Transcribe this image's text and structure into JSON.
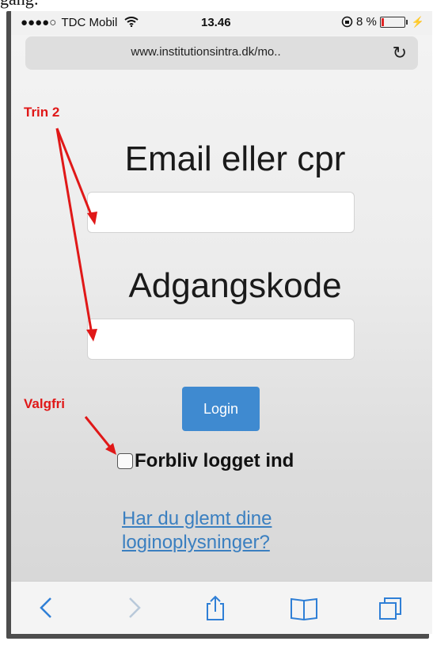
{
  "top_fragment": "gang:",
  "status": {
    "signal": "●●●●○",
    "carrier": "TDC Mobil",
    "time": "13.46",
    "battery": "8 %"
  },
  "browser": {
    "url": "www.institutionsintra.dk/mo..",
    "reload_icon": "reload-icon"
  },
  "annotations": {
    "step": "Trin 2",
    "optional": "Valgfri"
  },
  "form": {
    "email_label": "Email eller cpr",
    "email_value": "",
    "password_label": "Adgangskode",
    "password_value": "",
    "login_button": "Login",
    "remember_label": "Forbliv logget ind",
    "remember_checked": false,
    "forgot_link": "Har du glemt dine loginoplysninger?"
  },
  "toolbar": {
    "icons": [
      "back-icon",
      "forward-icon",
      "share-icon",
      "bookmarks-icon",
      "tabs-icon"
    ]
  },
  "colors": {
    "annotation": "#e01818",
    "login_button": "#3f8ad0",
    "link": "#3a7fc0"
  }
}
